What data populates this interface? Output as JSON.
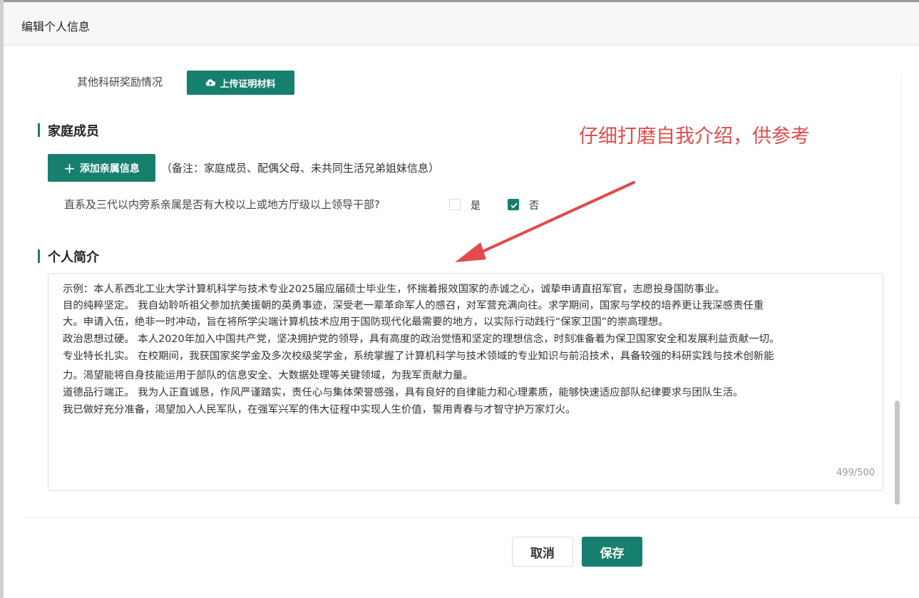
{
  "dialog": {
    "title": "编辑个人信息"
  },
  "research_awards": {
    "label": "其他科研奖励情况",
    "upload_button": "上传证明材料",
    "upload_icon": "cloud-upload-icon"
  },
  "family": {
    "section_title": "家庭成员",
    "add_button": "添加亲属信息",
    "add_icon": "plus-icon",
    "note": "（备注：家庭成员、配偶父母、未共同生活兄弟姐妹信息）",
    "question": "直系及三代以内旁系亲属是否有大校以上或地方厅级以上领导干部?",
    "options": [
      {
        "label": "是",
        "checked": false
      },
      {
        "label": "否",
        "checked": true
      }
    ]
  },
  "intro": {
    "section_title": "个人简介",
    "lines": [
      "示例：本人系西北工业大学计算机科学与技术专业2025届应届硕士毕业生，怀揣着报效国家的赤诚之心，诚挚申请直招军官，志愿投身国防事业。",
      "目的纯粹坚定。 我自幼聆听祖父参加抗美援朝的英勇事迹，深受老一辈革命军人的感召，对军营充满向往。求学期间，国家与学校的培养更让我深感责任重",
      "大。申请入伍，绝非一时冲动，旨在将所学尖端计算机技术应用于国防现代化最需要的地方，以实际行动践行“保家卫国”的崇高理想。",
      "政治思想过硬。 本人2020年加入中国共产党，坚决拥护党的领导，具有高度的政治觉悟和坚定的理想信念，时刻准备着为保卫国家安全和发展利益贡献一切。",
      "专业特长扎实。 在校期间，我获国家奖学金及多次校级奖学金，系统掌握了计算机科学与技术领域的专业知识与前沿技术，具备较强的科研实践与技术创新能",
      "力。渴望能将自身技能运用于部队的信息安全、大数据处理等关键领域，为我军贡献力量。",
      "道德品行端正。 我为人正直诚恳，作风严谨踏实，责任心与集体荣誉感强，具有良好的自律能力和心理素质，能够快速适应部队纪律要求与团队生活。",
      "我已做好充分准备，渴望加入人民军队，在强军兴军的伟大征程中实现人生价值，誓用青春与才智守护万家灯火。"
    ],
    "counter": "499/500"
  },
  "footer": {
    "cancel": "取消",
    "save": "保存"
  },
  "annotation": {
    "text": "仔细打磨自我介绍，供参考",
    "color": "#e14b4b"
  },
  "colors": {
    "primary": "#167f6d"
  }
}
